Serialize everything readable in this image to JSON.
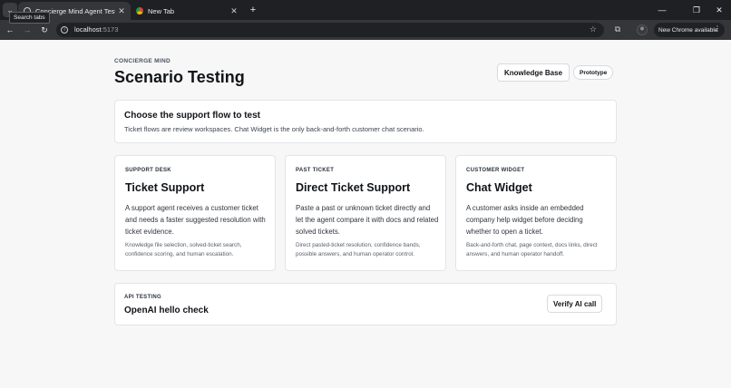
{
  "browser": {
    "tabs": [
      {
        "title": "Concierge Mind Agent Test",
        "active": true
      },
      {
        "title": "New Tab",
        "active": false
      }
    ],
    "tooltip": "Search tabs",
    "url_host": "localhost",
    "url_port": ":5173",
    "update_label": "New Chrome available",
    "icons": {
      "search_tabs": "chevron-down-icon",
      "close": "close-icon",
      "new_tab": "plus-icon",
      "back": "arrow-left-icon",
      "forward": "arrow-right-icon",
      "reload": "reload-icon",
      "site_info": "info-icon",
      "bookmark": "star-icon",
      "extensions": "puzzle-icon",
      "menu": "kebab-icon"
    }
  },
  "header": {
    "eyebrow": "CONCIERGE MIND",
    "title": "Scenario Testing",
    "knowledge_base_label": "Knowledge Base",
    "prototype_label": "Prototype"
  },
  "intro": {
    "title": "Choose the support flow to test",
    "description": "Ticket flows are review workspaces. Chat Widget is the only back-and-forth customer chat scenario."
  },
  "flows": [
    {
      "tag": "SUPPORT DESK",
      "title": "Ticket Support",
      "description": "A support agent receives a customer ticket and needs a faster suggested resolution with ticket evidence.",
      "note": "Knowledge file selection, solved-ticket search, confidence scoring, and human escalation."
    },
    {
      "tag": "PAST TICKET",
      "title": "Direct Ticket Support",
      "description": "Paste a past or unknown ticket directly and let the agent compare it with docs and related solved tickets.",
      "note": "Direct pasted-ticket resolution, confidence bands, possible answers, and human operator control."
    },
    {
      "tag": "CUSTOMER WIDGET",
      "title": "Chat Widget",
      "description": "A customer asks inside an embedded company help widget before deciding whether to open a ticket.",
      "note": "Back-and-forth chat, page context, docs links, direct answers, and human operator handoff."
    }
  ],
  "api_testing": {
    "tag": "API TESTING",
    "title": "OpenAI hello check",
    "button_label": "Verify AI call"
  }
}
